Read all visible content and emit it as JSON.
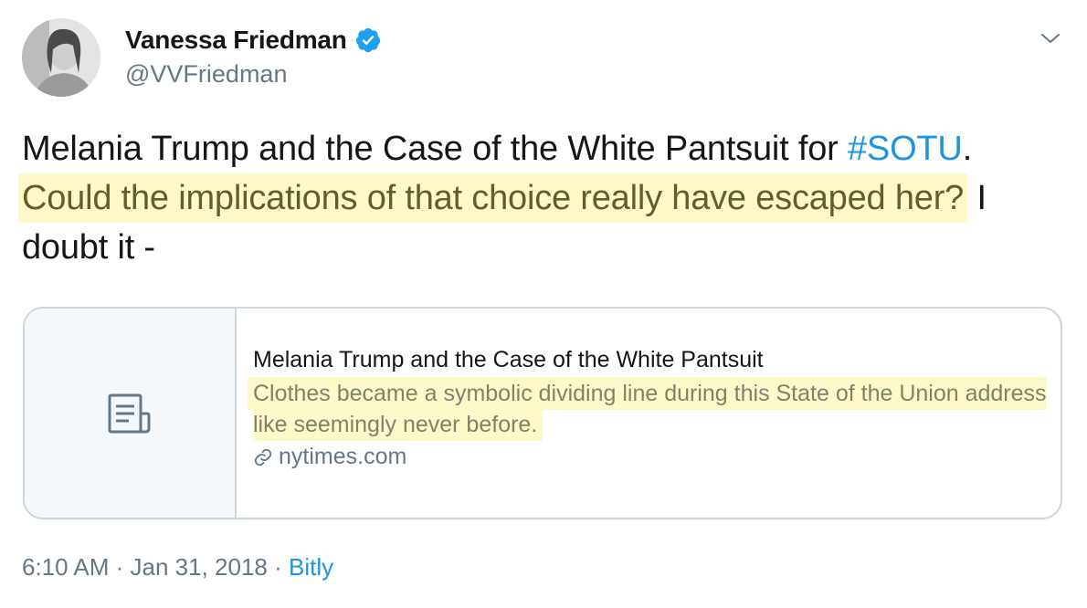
{
  "author": {
    "display_name": "Vanessa Friedman",
    "handle": "@VVFriedman",
    "verified": true
  },
  "tweet": {
    "text_part1": "Melania Trump and the Case of the White Pantsuit for ",
    "hashtag": "#SOTU",
    "text_part2": ".",
    "highlighted": "Could the implications of that choice really have escaped her?",
    "text_part3": " I doubt it -"
  },
  "card": {
    "title": "Melania Trump and the Case of the White Pantsuit",
    "description": "Clothes became a symbolic dividing line during this State of the Union address like seemingly never before.",
    "domain": "nytimes.com",
    "icon": "document-icon"
  },
  "meta": {
    "time": "6:10 AM",
    "separator": " · ",
    "date": "Jan 31, 2018",
    "source": "Bitly"
  },
  "colors": {
    "link": "#1b95e0",
    "secondary_text": "#657786",
    "highlight_bg": "#fdf9c8",
    "verified_badge": "#1da1f2"
  }
}
